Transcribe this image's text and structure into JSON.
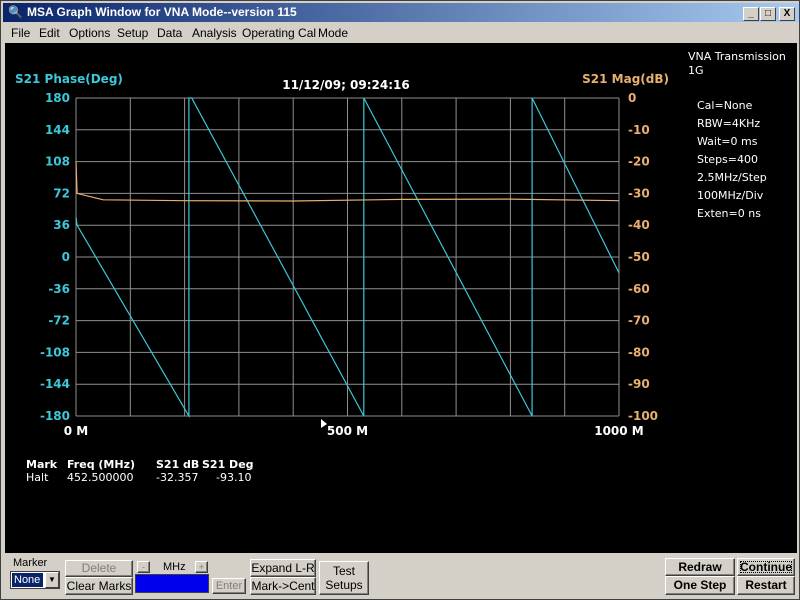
{
  "window": {
    "title": "MSA Graph Window for VNA Mode--version 115",
    "controls": [
      "_",
      "□",
      "X"
    ]
  },
  "menu": [
    "File",
    "Edit",
    "Options",
    "Setup",
    "Data",
    "Analysis",
    "Operating Cal",
    "Mode"
  ],
  "graph": {
    "left_axis_title": "S21 Phase(Deg)",
    "right_axis_title": "S21 Mag(dB)",
    "timestamp": "11/12/09; 09:24:16",
    "colors": {
      "phase": "#3cc8d8",
      "mag": "#e8b070",
      "grid": "#909090",
      "bg": "#000000"
    }
  },
  "side_info": {
    "title": "VNA Transmission",
    "subtitle": "1G",
    "lines": [
      "Cal=None",
      "RBW=4KHz",
      "Wait=0 ms",
      "Steps=400",
      "2.5MHz/Step",
      "100MHz/Div",
      "Exten=0 ns"
    ]
  },
  "marker_table": {
    "headers": [
      "Mark",
      "Freq (MHz)",
      "S21 dB",
      "S21 Deg"
    ],
    "row": [
      "Halt",
      "452.500000",
      "-32.357",
      "-93.10"
    ]
  },
  "chart_data": {
    "type": "line",
    "x_ticks": [
      "0 M",
      "500 M",
      "1000 M"
    ],
    "x_range_mhz": [
      0,
      1000
    ],
    "left_ticks": [
      "180",
      "144",
      "108",
      "72",
      "36",
      "0",
      "-36",
      "-72",
      "-108",
      "-144",
      "-180"
    ],
    "right_ticks": [
      "0",
      "-10",
      "-20",
      "-30",
      "-40",
      "-50",
      "-60",
      "-70",
      "-80",
      "-90",
      "-100"
    ],
    "ylim_left": [
      -180,
      180
    ],
    "ylim_right": [
      -100,
      0
    ],
    "grid": true,
    "series": [
      {
        "name": "S21 Phase(Deg)",
        "axis": "left",
        "points": [
          [
            0,
            45
          ],
          [
            2,
            36
          ],
          [
            208,
            -180
          ],
          [
            208,
            180
          ],
          [
            213,
            180
          ],
          [
            530,
            -180
          ],
          [
            530,
            180
          ],
          [
            840,
            -180
          ],
          [
            840,
            180
          ],
          [
            1000,
            -18
          ]
        ]
      },
      {
        "name": "S21 Mag(dB)",
        "axis": "right",
        "points": [
          [
            0,
            -20
          ],
          [
            2,
            -30
          ],
          [
            50,
            -32
          ],
          [
            200,
            -32.3
          ],
          [
            400,
            -32.4
          ],
          [
            600,
            -31.9
          ],
          [
            800,
            -31.8
          ],
          [
            1000,
            -32.3
          ]
        ]
      }
    ]
  },
  "controls": {
    "marker_label": "Marker",
    "marker_select": "None",
    "delete": "Delete",
    "clear_marks": "Clear Marks",
    "minus": "-",
    "mhz": "MHz",
    "plus": "+",
    "enter": "Enter",
    "expand": "Expand L-R",
    "mark_cent": "Mark->Cent",
    "test_setups": [
      "Test",
      "Setups"
    ],
    "redraw": "Redraw",
    "continue": "Continue",
    "one_step": "One Step",
    "restart": "Restart"
  }
}
